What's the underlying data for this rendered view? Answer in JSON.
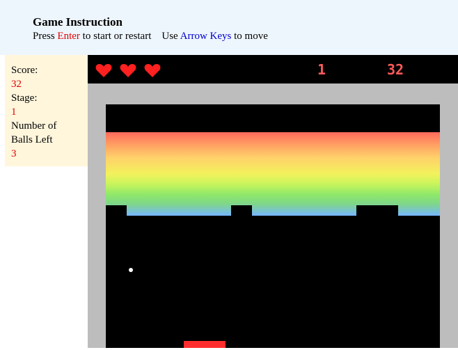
{
  "header": {
    "title": "Game Instruction",
    "press": "Press ",
    "enter_key": "Enter",
    "restart_text": " to start or restart    Use ",
    "arrow_keys": "Arrow Keys",
    "move_text": " to move"
  },
  "sidebar": {
    "score_label": "Score:",
    "score_value": "32",
    "stage_label": "Stage:",
    "stage_value": "1",
    "balls_label_1": "Number of",
    "balls_label_2": "Balls Left",
    "balls_value": "3"
  },
  "hud": {
    "lives": 3,
    "stage": "1",
    "score": "32"
  },
  "colors": {
    "accent_red": "#e00000",
    "key_blue": "#0000cc",
    "hud_text": "#ff5a5a",
    "heart": "#ff2020",
    "wall": "#bdbdbd",
    "paddle": "#ff2d2d"
  }
}
